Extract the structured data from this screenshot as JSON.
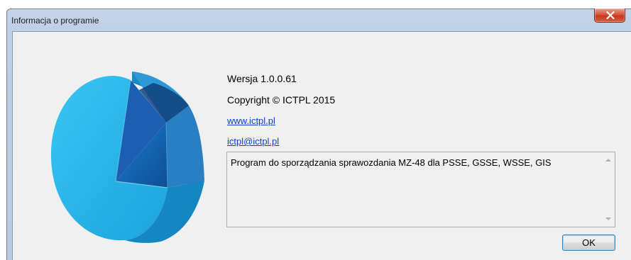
{
  "window": {
    "title": "Informacja o programie",
    "close_icon": "close-x-icon"
  },
  "about": {
    "version": "Wersja 1.0.0.61",
    "copyright": "Copyright © ICTPL 2015",
    "website": "www.ictpl.pl",
    "email": "ictpl@ictpl.pl",
    "description": "Program do sporządzania sprawozdania MZ-48 dla PSSE, GSSE, WSSE, GIS"
  },
  "buttons": {
    "ok_label": "OK"
  },
  "logo": {
    "icon": "pie-chart-logo",
    "colors": [
      "#1eb8ee",
      "#2a8fd0",
      "#1b6fb4",
      "#0f4f8f"
    ]
  }
}
